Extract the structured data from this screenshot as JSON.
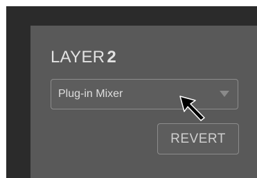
{
  "panel": {
    "title_prefix": "LAYER",
    "title_number": "2"
  },
  "select": {
    "value": "Plug-in Mixer",
    "caret_icon": "chevron-down-icon"
  },
  "revert_label": "REVERT",
  "cursor_icon": "mouse-pointer-icon",
  "colors": {
    "frame_bg": "#2b2b2b",
    "panel_bg": "#595959",
    "text": "#e2e2e2",
    "border": "#8d8d8d"
  }
}
